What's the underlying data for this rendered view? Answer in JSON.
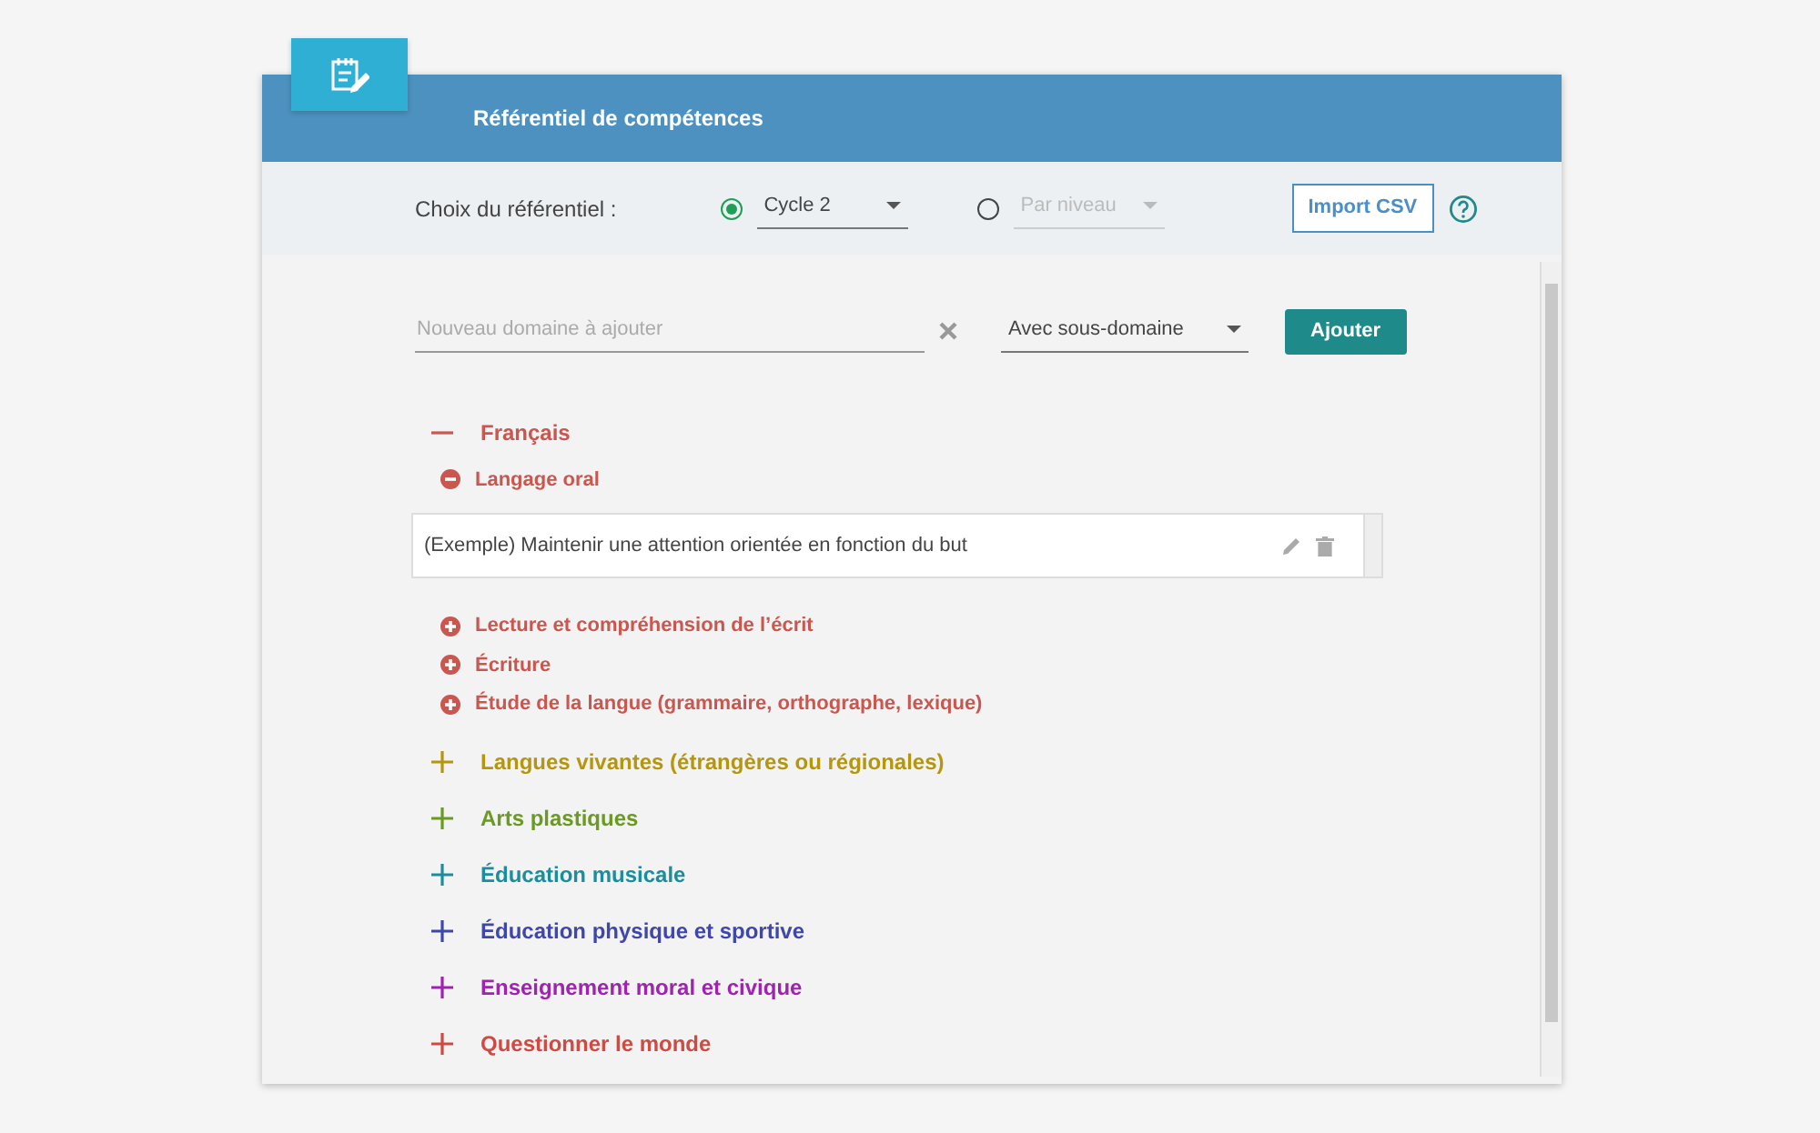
{
  "header": {
    "title": "Référentiel de compétences"
  },
  "filter": {
    "label": "Choix du référentiel :",
    "options": [
      {
        "selected": true,
        "value": "Cycle 2",
        "disabled": false
      },
      {
        "selected": false,
        "value": "Par niveau",
        "disabled": true
      }
    ],
    "import_button": "Import CSV"
  },
  "add_form": {
    "placeholder": "Nouveau domaine à ajouter",
    "type_select": "Avec sous-domaine",
    "add_button": "Ajouter"
  },
  "domains": [
    {
      "name": "Français",
      "color": "#c9574f",
      "expanded": true,
      "subdomains": [
        {
          "name": "Langage oral",
          "expanded": true,
          "items": [
            "(Exemple) Maintenir une attention orientée en fonction du but"
          ]
        },
        {
          "name": "Lecture et compréhension de l’écrit",
          "expanded": false
        },
        {
          "name": "Écriture",
          "expanded": false
        },
        {
          "name": "Étude de la langue (grammaire, orthographe, lexique)",
          "expanded": false
        }
      ]
    },
    {
      "name": "Langues vivantes (étrangères ou régionales)",
      "color": "#b5960f",
      "expanded": false
    },
    {
      "name": "Arts plastiques",
      "color": "#6b9a22",
      "expanded": false
    },
    {
      "name": "Éducation musicale",
      "color": "#1b8e9e",
      "expanded": false
    },
    {
      "name": "Éducation physique et sportive",
      "color": "#3f48a8",
      "expanded": false
    },
    {
      "name": "Enseignement moral et civique",
      "color": "#a022b0",
      "expanded": false
    },
    {
      "name": "Questionner le monde",
      "color": "#cf4a43",
      "expanded": false
    }
  ]
}
